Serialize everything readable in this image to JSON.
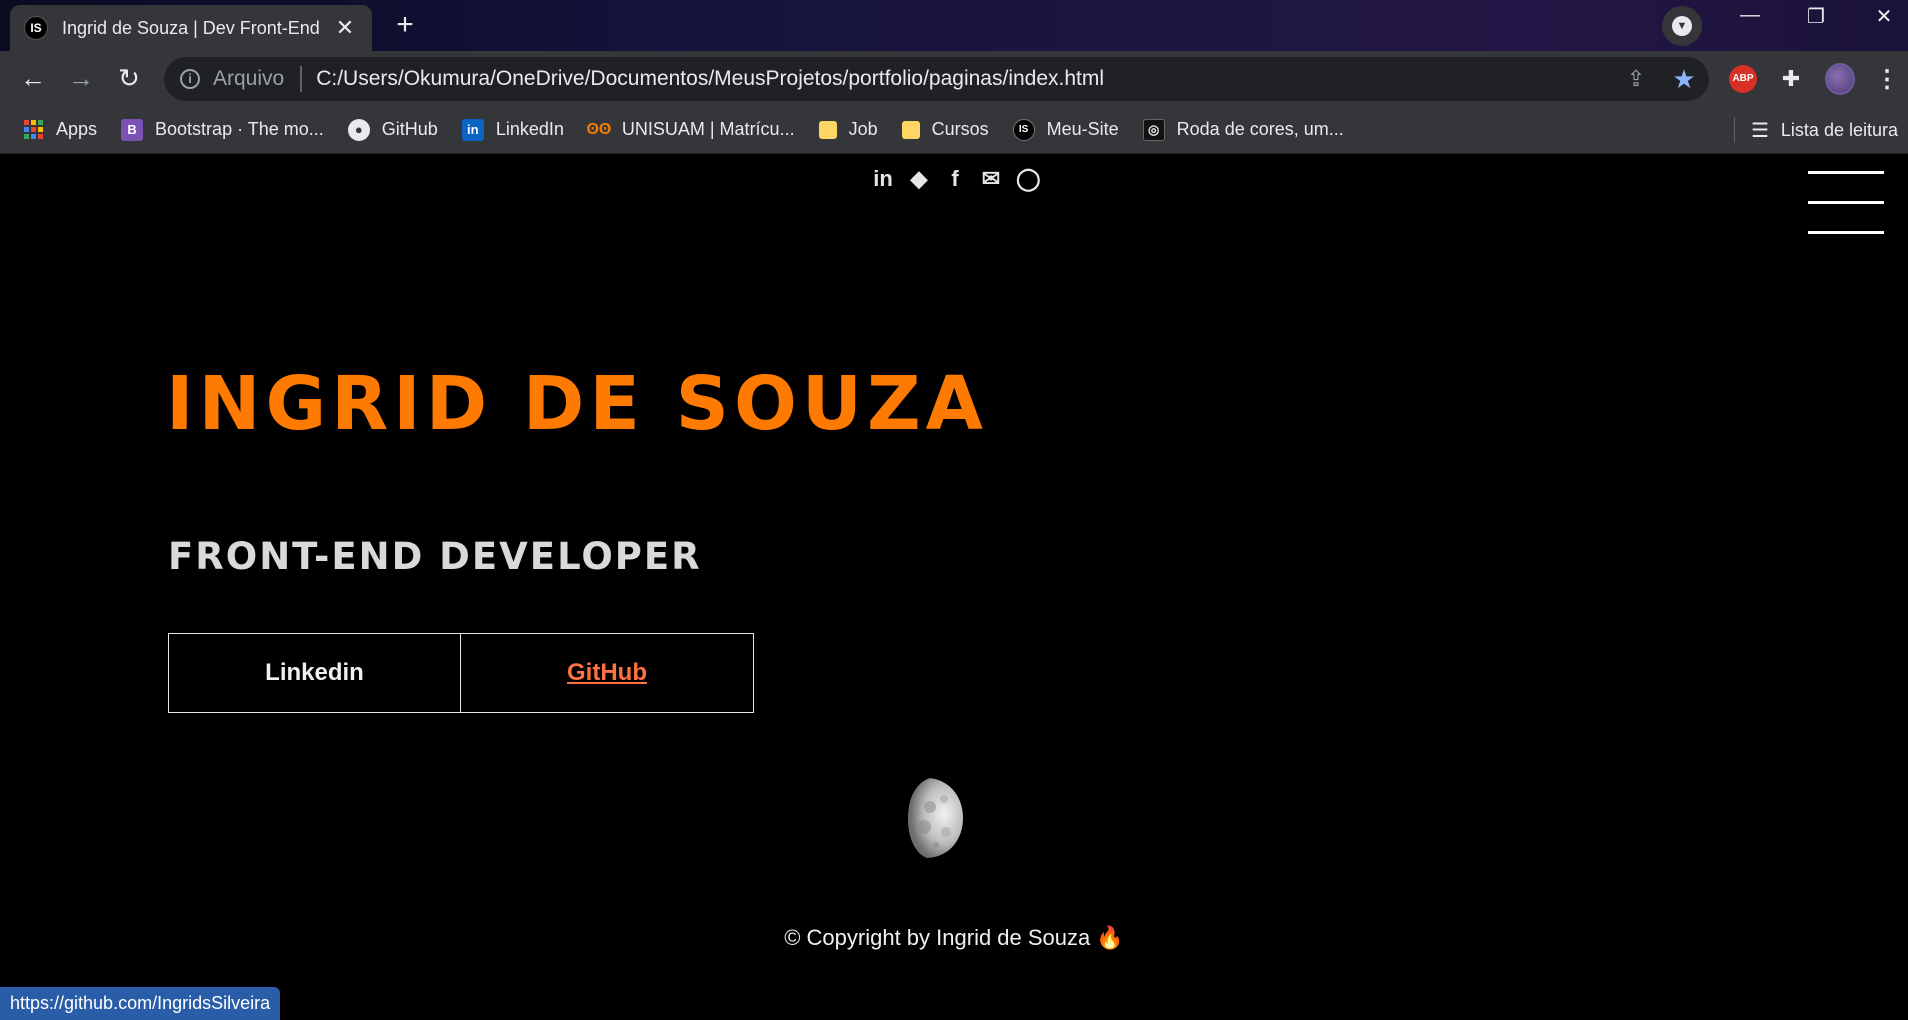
{
  "tab": {
    "favicon": "IS",
    "title": "Ingrid de Souza | Dev Front-End",
    "close": "✕"
  },
  "newtab": "+",
  "window": {
    "minimize": "—",
    "restore": "❐",
    "close": "✕"
  },
  "toolbar": {
    "back": "←",
    "forward": "→",
    "reload": "↻",
    "scheme": "Arquivo",
    "url": "C:/Users/Okumura/OneDrive/Documentos/MeusProjetos/portfolio/paginas/index.html",
    "abp": "ABP"
  },
  "bookmarks": [
    {
      "label": "Apps",
      "icon": "apps-grid"
    },
    {
      "label": "Bootstrap · The mo...",
      "icon": "B"
    },
    {
      "label": "GitHub",
      "icon": "github"
    },
    {
      "label": "LinkedIn",
      "icon": "in"
    },
    {
      "label": "UNISUAM | Matrícu...",
      "icon": "owl"
    },
    {
      "label": "Job",
      "icon": "folder"
    },
    {
      "label": "Cursos",
      "icon": "folder"
    },
    {
      "label": "Meu-Site",
      "icon": "IS"
    },
    {
      "label": "Roda de cores, um...",
      "icon": "color-wheel"
    }
  ],
  "reading_list": "Lista de leitura",
  "page": {
    "name": "INGRID DE SOUZA",
    "role": "FRONT-END DEVELOPER",
    "buttons": {
      "linkedin": "Linkedin",
      "github": "GitHub"
    },
    "copyright": "© Copyright by Ingrid de Souza 🔥"
  },
  "status_url": "https://github.com/IngridsSilveira",
  "colors": {
    "accent": "#ff7a00",
    "link_hover": "#ff7043",
    "background": "#000000"
  }
}
